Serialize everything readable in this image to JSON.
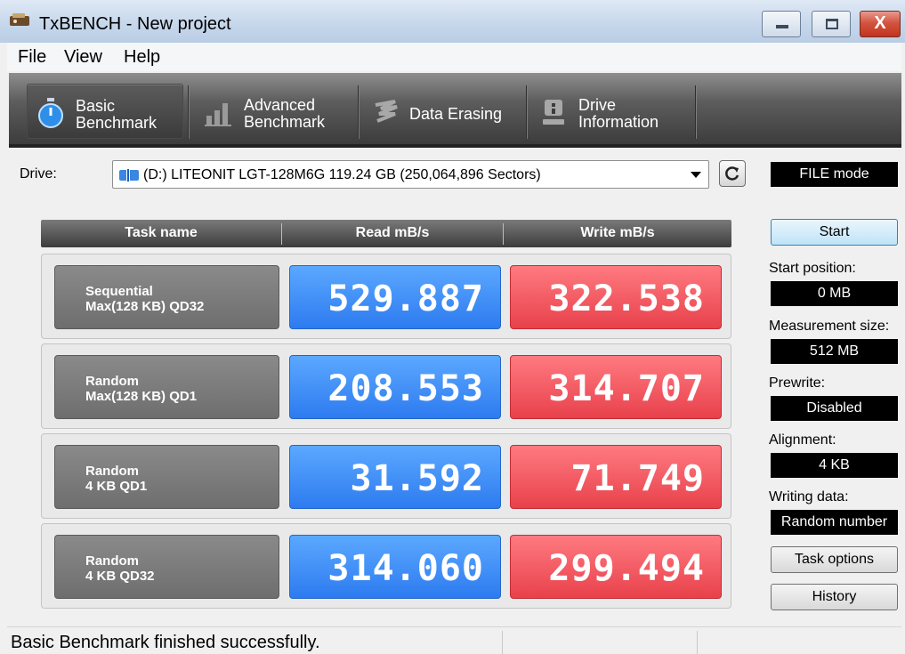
{
  "window": {
    "title": "TxBENCH - New project",
    "caption_close": "X"
  },
  "menu": [
    "File",
    "View",
    "Help"
  ],
  "tabs": [
    {
      "line1": "Basic",
      "line2": "Benchmark",
      "icon": "stopwatch-icon",
      "active": true
    },
    {
      "line1": "Advanced",
      "line2": "Benchmark",
      "icon": "bar-chart-icon",
      "active": false
    },
    {
      "line1": "Data Erasing",
      "line2": "",
      "icon": "eraser-icon",
      "active": false
    },
    {
      "line1": "Drive",
      "line2": "Information",
      "icon": "drive-info-icon",
      "active": false
    }
  ],
  "drive": {
    "label": "Drive:",
    "selected": "(D:) LITEONIT LGT-128M6G  119.24 GB (250,064,896 Sectors)"
  },
  "mode": "FILE mode",
  "table": {
    "headers": {
      "task": "Task name",
      "read": "Read mB/s",
      "write": "Write mB/s"
    },
    "rows": [
      {
        "line1": "Sequential",
        "line2": "Max(128 KB) QD32",
        "read": "529.887",
        "write": "322.538"
      },
      {
        "line1": "Random",
        "line2": "Max(128 KB) QD1",
        "read": "208.553",
        "write": "314.707"
      },
      {
        "line1": "Random",
        "line2": "4 KB QD1",
        "read": "31.592",
        "write": "71.749"
      },
      {
        "line1": "Random",
        "line2": "4 KB QD32",
        "read": "314.060",
        "write": "299.494"
      }
    ]
  },
  "side": {
    "start": "Start",
    "start_position_label": "Start position:",
    "start_position": "0 MB",
    "measurement_size_label": "Measurement size:",
    "measurement_size": "512 MB",
    "prewrite_label": "Prewrite:",
    "prewrite": "Disabled",
    "alignment_label": "Alignment:",
    "alignment": "4 KB",
    "writing_data_label": "Writing data:",
    "writing_data": "Random number",
    "task_options": "Task options",
    "history": "History"
  },
  "status": "Basic Benchmark finished successfully.",
  "colors": {
    "read": "#2d7bf0",
    "write": "#e8414b",
    "header": "#3c3c3c"
  }
}
